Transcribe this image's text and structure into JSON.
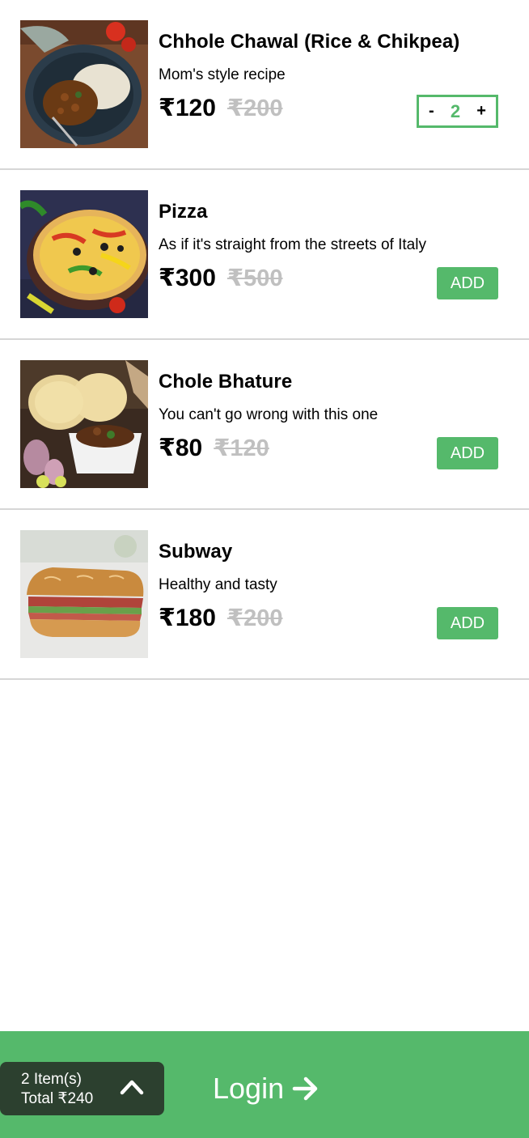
{
  "menu": {
    "items": [
      {
        "name": "Chhole Chawal (Rice & Chikpea)",
        "description": "Mom's style recipe",
        "price": "₹120",
        "mrp": "₹200",
        "image_icon": "chhole-chawal-photo",
        "in_cart": true,
        "quantity": "2",
        "minus_label": "-",
        "plus_label": "+"
      },
      {
        "name": "Pizza",
        "description": "As if it's straight from the streets of Italy",
        "price": "₹300",
        "mrp": "₹500",
        "image_icon": "pizza-photo",
        "in_cart": false,
        "add_label": "ADD"
      },
      {
        "name": "Chole Bhature",
        "description": "You can't go wrong with this one",
        "price": "₹80",
        "mrp": "₹120",
        "image_icon": "chole-bhature-photo",
        "in_cart": false,
        "add_label": "ADD"
      },
      {
        "name": "Subway",
        "description": "Healthy and tasty",
        "price": "₹180",
        "mrp": "₹200",
        "image_icon": "subway-sandwich-photo",
        "in_cart": false,
        "add_label": "ADD"
      }
    ]
  },
  "cart_bar": {
    "item_count": "2 Item(s)",
    "total": "Total ₹240",
    "expand_icon": "chevron-up-icon",
    "login_label": "Login",
    "login_icon": "arrow-right-icon"
  },
  "colors": {
    "accent": "#55b96b",
    "cart_pill": "#2c402f",
    "strike_price": "#c0c0c0",
    "divider": "#d6d6d6"
  }
}
